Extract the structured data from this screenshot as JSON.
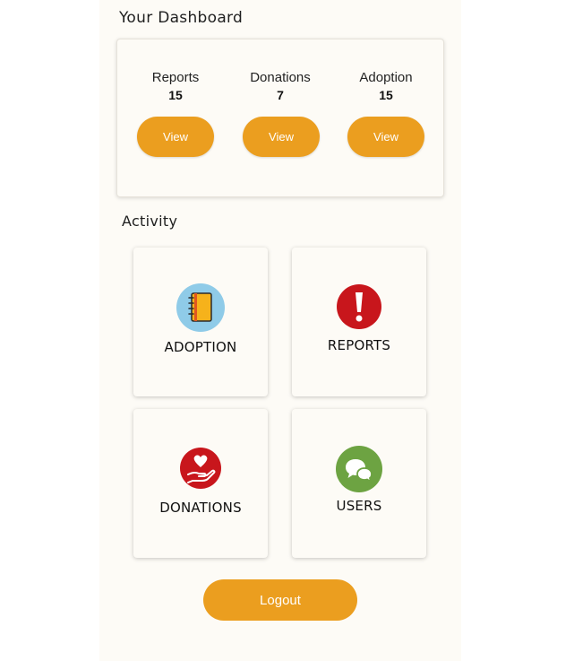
{
  "dashboard": {
    "title": "Your Dashboard",
    "stats": [
      {
        "label": "Reports",
        "value": "15",
        "button": "View"
      },
      {
        "label": "Donations",
        "value": "7",
        "button": "View"
      },
      {
        "label": "Adoption",
        "value": "15",
        "button": "View"
      }
    ]
  },
  "activity": {
    "title": "Activity",
    "tiles": [
      {
        "label": "ADOPTION",
        "icon": "notebook-icon",
        "color": "#8fcbe8"
      },
      {
        "label": "REPORTS",
        "icon": "exclamation-icon",
        "color": "#c8161c"
      },
      {
        "label": "DONATIONS",
        "icon": "heart-hand-icon",
        "color": "#c8161c"
      },
      {
        "label": "USERS",
        "icon": "chat-bubbles-icon",
        "color": "#6da342"
      }
    ]
  },
  "logout_label": "Logout",
  "colors": {
    "accent": "#eb9e1f",
    "background": "#fdfbf6"
  }
}
